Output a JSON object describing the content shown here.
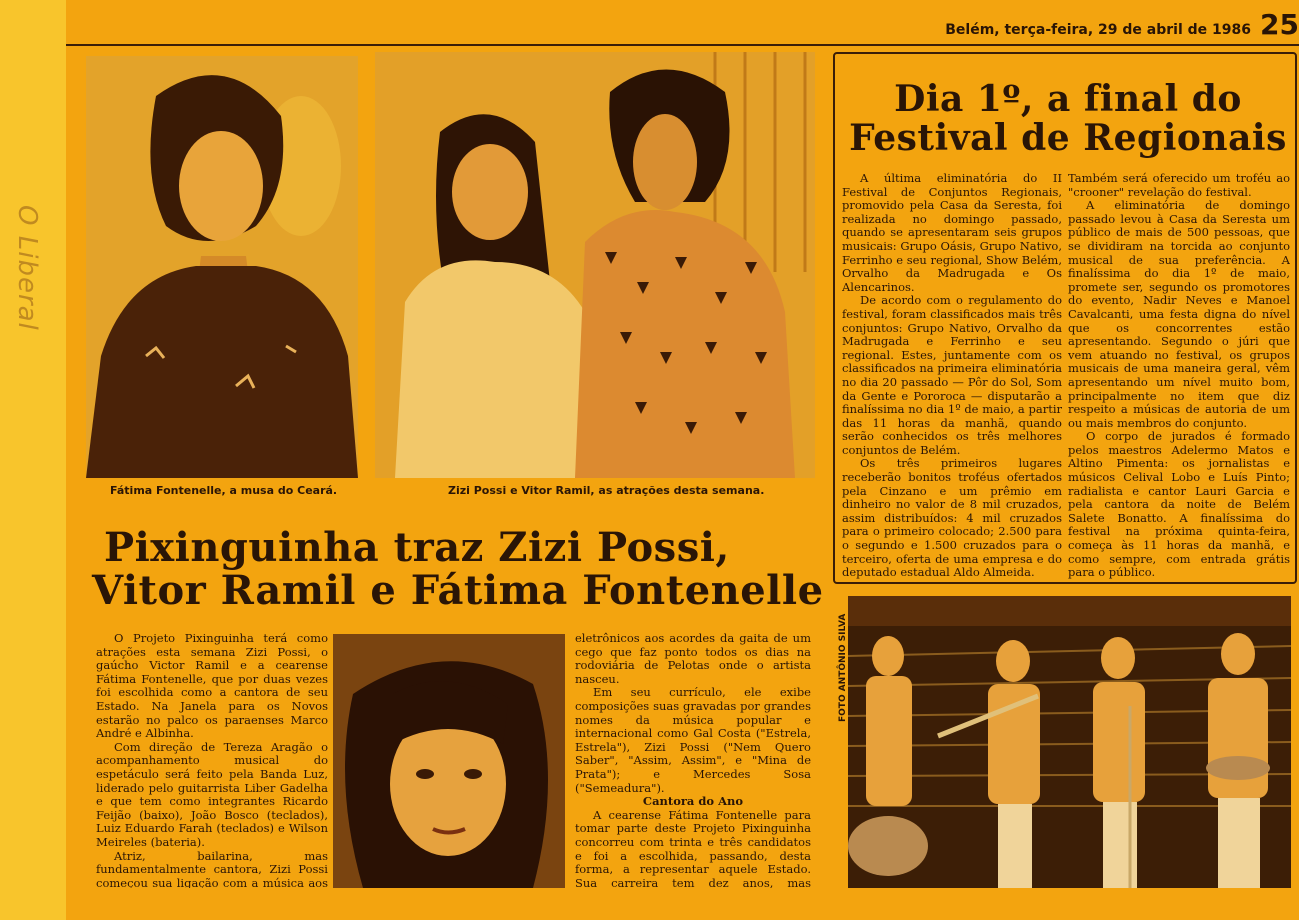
{
  "header": {
    "dateline": "Belém, terça-feira, 29 de abril de 1986",
    "page_number": "25"
  },
  "margin_note": "O Liberal",
  "main": {
    "captions": {
      "left": "Fátima Fontenelle, a musa do Ceará.",
      "right": "Zizi Possi e Vitor Ramil, as atrações desta semana."
    },
    "headline": [
      "Pixinguinha traz Zizi  Possi,",
      "Vitor Ramil e Fátima Fontenelle"
    ],
    "col1": [
      "O Projeto Pixinguinha terá como atrações esta semana Zizi Possi, o gaúcho Victor Ramil e a cearense Fátima Fontenelle, que por duas vezes foi escolhida como a cantora de seu Estado. Na Janela para os Novos estarão no palco os paraenses Marco André e Albinha.",
      "Com direção de Tereza Aragão o acompanhamento musical do espetáculo será feito pela Banda Luz, liderado pelo guitarrista Liber Gadelha e que tem como integrantes Ricardo Feijão (baixo), João Bosco (teclados), Luiz Eduardo Farah (teclados) e Wilson Meireles (bateria).",
      "Atriz, bailarina, mas fundamentalmente cantora, Zizi Possi começou sua ligação com a música aos cinco anos de idade quando foi estudar piano num con-"
    ],
    "col3": {
      "p1": "eletrônicos aos acordes da gaita de um cego que faz ponto todos os dias na rodoviária de Pelotas onde o artista nasceu.",
      "p2": "Em seu currículo, ele exibe composições suas gravadas por grandes nomes da música popular e internacional como Gal Costa (\"Estrela, Estrela\"), Zizi Possi (\"Nem Quero Saber\", \"Assim, Assim\", e \"Mina de Prata\"); e Mercedes Sosa (\"Semeadura\").",
      "subhead": "Cantora do Ano",
      "p3": "A cearense Fátima Fontenelle para tomar parte deste Projeto Pixinguinha concorreu com trinta e três candidatos e foi a escolhida, passando, desta forma, a representar aquele Estado. Sua carreira tem dez anos, mas somente há seis que ela resolveu"
    }
  },
  "festival": {
    "headline": [
      "Dia 1º, a final do",
      "Festival de Regionais"
    ],
    "col1": [
      "A última eliminatória do II Festival de Conjuntos Regionais, promovido pela Casa da Seresta, foi realizada no domingo passado, quando se apresentaram seis grupos musicais: Grupo Oásis, Grupo Nativo, Ferrinho e seu regional, Show Belém, Orvalho da Madrugada e Os Alencarinos.",
      "De acordo com o regulamento do festival, foram classificados mais três conjuntos: Grupo Nativo, Orvalho da Madrugada e Ferrinho e seu regional. Estes, juntamente com os classificados na primeira eliminatória no dia 20 passado — Pôr do Sol, Som da Gente e Pororoca — disputarão a finalíssima no dia 1º de maio, a partir das 11 horas da manhã, quando serão conhecidos os três melhores conjuntos de Belém.",
      "Os três primeiros lugares receberão bonitos troféus ofertados pela Cinzano e um prêmio em dinheiro no valor de 8 mil cruzados, assim distribuídos: 4 mil cruzados para o primeiro colocado; 2.500 para o segundo e 1.500 cruzados para o terceiro, oferta de uma empresa e do deputado estadual Aldo Almeida."
    ],
    "col2": [
      "Também será oferecido um troféu ao \"crooner\" revelação do festival.",
      "A eliminatória de domingo passado levou à Casa da Seresta um público de mais de 500 pessoas, que se dividiram na torcida ao conjunto musical de sua preferência. A finalíssima do dia 1º de maio, promete ser, segundo os promotores do evento, Nadir Neves e Manoel Cavalcanti, uma festa digna do nível que os concorrentes estão apresentando. Segundo o júri que vem atuando no festival, os grupos musicais de uma maneira geral, vêm apresentando um nível muito bom, principalmente no item que diz respeito a músicas de autoria de um ou mais membros do conjunto.",
      "O corpo de jurados é formado pelos maestros Adelermo Matos e Altino Pimenta: os jornalistas e músicos Celival Lobo e Luís Pinto; radialista e cantor Lauri Garcia e pela cantora da noite de Belém Salete Bonatto. A finalíssima do festival na próxima quinta-feira, começa às 11 horas da manhã, e como sempre, com entrada grátis para o público."
    ],
    "photo_credit": "FOTO ANTÔNIO SILVA"
  }
}
